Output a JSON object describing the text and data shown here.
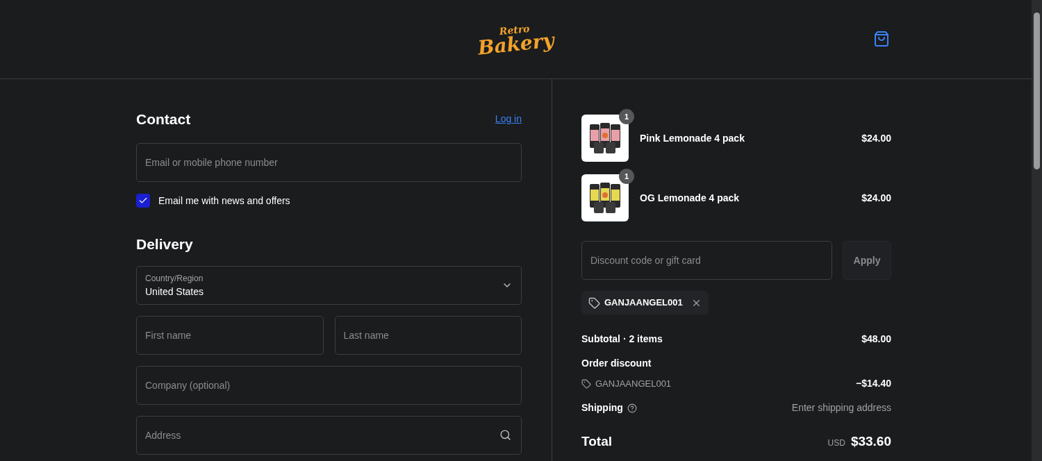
{
  "header": {
    "logo": {
      "line_1": "Retro",
      "line_2": "Bakery"
    }
  },
  "contact": {
    "title": "Contact",
    "login_link": "Log in",
    "email": {
      "placeholder": "Email or mobile phone number"
    },
    "newsletter": {
      "label": "Email me with news and offers",
      "checked": true
    }
  },
  "delivery": {
    "title": "Delivery",
    "country": {
      "label": "Country/Region",
      "value": "United States"
    },
    "fields": [
      {
        "placeholder": "First name",
        "kind": "half"
      },
      {
        "placeholder": "Last name",
        "kind": "half"
      },
      {
        "placeholder": "Company (optional)",
        "kind": "full"
      },
      {
        "placeholder": "Address",
        "kind": "search"
      }
    ]
  },
  "cart": {
    "items": [
      {
        "quantity": "1",
        "name": "Pink Lemonade 4 pack",
        "price": "$24.00"
      },
      {
        "quantity": "1",
        "name": "OG Lemonade 4 pack",
        "price": "$24.00"
      }
    ],
    "discount": {
      "placeholder": "Discount code or gift card",
      "button": "Apply",
      "applied_code": "GANJAANGEL001"
    },
    "summary": {
      "subtotal_label": "Subtotal · 2 items",
      "subtotal": "$48.00",
      "discount_label": "Order discount",
      "discount_code": "GANJAANGEL001",
      "discount_amount": "−$14.40",
      "shipping_label": "Shipping",
      "shipping_value": "Enter shipping address",
      "total_label": "Total",
      "currency": "USD",
      "total": "$33.60"
    }
  }
}
